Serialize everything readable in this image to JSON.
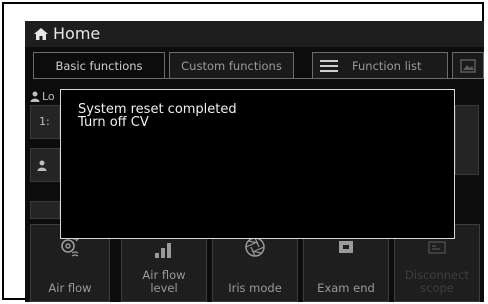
{
  "header": {
    "title": "Home"
  },
  "tabs": {
    "basic": "Basic functions",
    "custom": "Custom functions",
    "list": "Function list"
  },
  "background": {
    "row1_label": "Lo",
    "row1_value": "1:"
  },
  "buttons": [
    {
      "label": "Air flow"
    },
    {
      "label": "Air flow\nlevel"
    },
    {
      "label": "Iris mode"
    },
    {
      "label": "Exam end"
    },
    {
      "label": "Disconnect\nscope"
    }
  ],
  "modal": {
    "line1": "System reset completed",
    "line2": "Turn off CV"
  },
  "colors": {
    "screen_bg": "#0c0c0c",
    "modal_border": "#d8d8d8",
    "text": "#f0f0f0"
  }
}
